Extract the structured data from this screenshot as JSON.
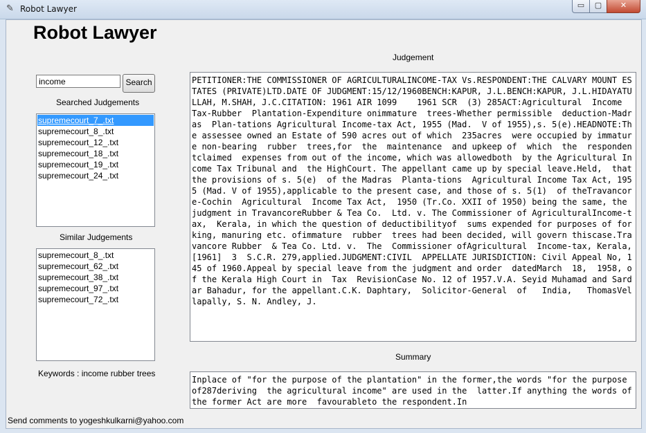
{
  "window": {
    "title": "Robot Lawyer",
    "controls": {
      "minimize": "▭",
      "maximize": "▢",
      "close": "✕"
    }
  },
  "app": {
    "heading": "Robot Lawyer"
  },
  "search": {
    "value": "income",
    "button_label": "Search"
  },
  "searched": {
    "label": "Searched Judgements",
    "items": [
      "supremecourt_7_.txt",
      "supremecourt_8_.txt",
      "supremecourt_12_.txt",
      "supremecourt_18_.txt",
      "supremecourt_19_.txt",
      "supremecourt_24_.txt"
    ],
    "selected_index": 0
  },
  "similar": {
    "label": "Similar Judgements",
    "items": [
      "supremecourt_8_.txt",
      "supremecourt_62_.txt",
      "supremecourt_38_.txt",
      "supremecourt_97_.txt",
      "supremecourt_72_.txt"
    ]
  },
  "keywords": {
    "text": "Keywords : income rubber trees"
  },
  "judgement": {
    "label": "Judgement",
    "text": "PETITIONER:THE COMMISSIONER OF AGRICULTURALINCOME-TAX Vs.RESPONDENT:THE CALVARY MOUNT ESTATES (PRIVATE)LTD.DATE OF JUDGMENT:15/12/1960BENCH:KAPUR, J.L.BENCH:KAPUR, J.L.HIDAYATULLAH, M.SHAH, J.C.CITATION: 1961 AIR 1099    1961 SCR  (3) 285ACT:Agricultural  Income  Tax-Rubber  Plantation-Expenditure onimmature  trees-Whether permissible  deduction-Madras  Plan-tations Agricultural Income-tax Act, 1955 (Mad.  V of 1955),s. 5(e).HEADNOTE:The assessee owned an Estate of 590 acres out of which  235acres  were occupied by immature non-bearing  rubber  trees,for  the  maintenance  and upkeep of  which  the  respondentclaimed  expenses from out of the income, which was allowedboth  by the Agricultural Income Tax Tribunal and  the HighCourt. The appellant came up by special leave.Held,  that the provisions of s. 5(e)  of the Madras  Planta-tions  Agricultural Income Tax Act, 1955 (Mad. V of 1955),applicable to the present case, and those of s. 5(1)  of theTravancore-Cochin  Agricultural  Income Tax Act,  1950 (Tr.Co. XXII of 1950) being the same, the judgment in TravancoreRubber & Tea Co.  Ltd. v. The Commissioner of AgriculturalIncome-tax,  Kerala, in which the question of deductibilityof  sums expended for purposes of forking, manuring etc. ofimmature  rubber  trees had been decided, will govern thiscase.Travancore Rubber  & Tea Co. Ltd. v.  The  Commissioner ofAgricultural  Income-tax, Kerala,  [1961]  3  S.C.R. 279,applied.JUDGMENT:CIVIL  APPELLATE JURISDICTION: Civil Appeal No, 145 of 1960.Appeal by special leave from the judgment and order  datedMarch  18,  1958, of the Kerala High Court in  Tax  RevisionCase No. 12 of 1957.V.A. Seyid Muhamad and Sardar Bahadur, for the appellant.C.K. Daphtary,  Solicitor-General  of   India,   ThomasVellapally, S. N. Andley, J."
  },
  "summary": {
    "label": "Summary",
    "text": "Inplace of \"for the purpose of the plantation\" in the former,the words \"for the purpose of287deriving  the agricultural income\" are used in the  latter.If anything the words of the former Act are more  favourableto the respondent.In"
  },
  "status": {
    "text": "Send comments to yogeshkulkarni@yahoo.com"
  }
}
